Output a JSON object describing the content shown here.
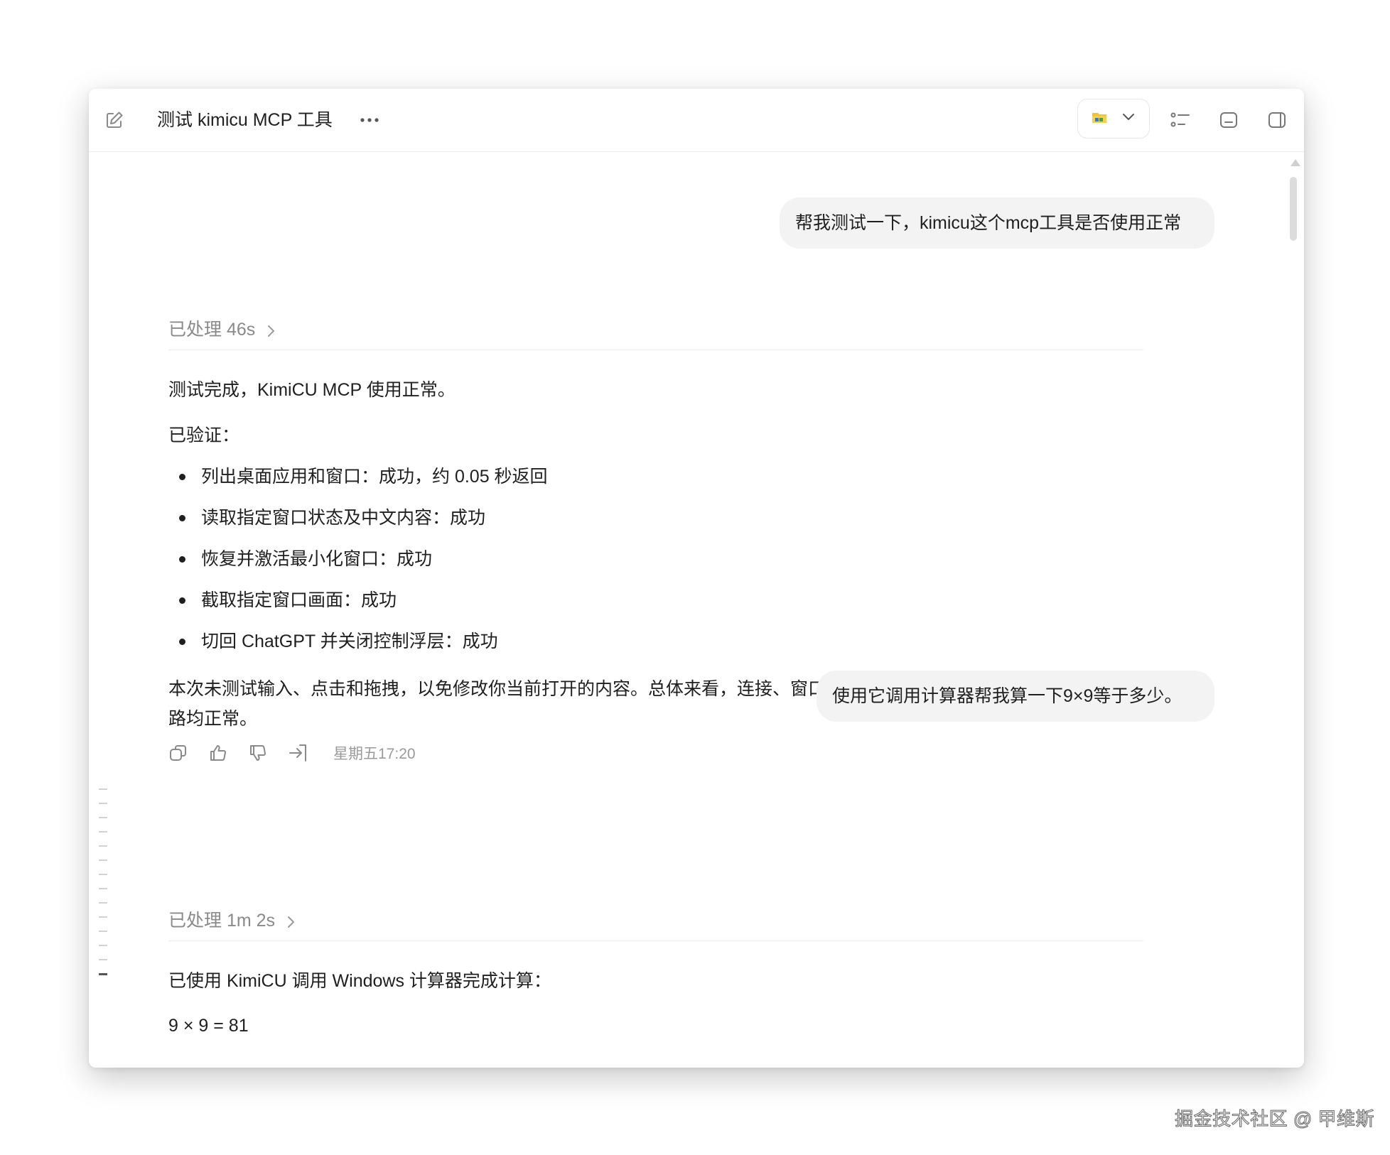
{
  "window": {
    "title": "测试 kimicu MCP 工具"
  },
  "icons": {
    "new_chat": "edit-icon",
    "more": "more-dots-icon",
    "workspace": "folder-icon",
    "dropdown": "chevron-down-icon",
    "list": "list-icon",
    "minimize": "minimize-icon",
    "panel": "side-panel-icon"
  },
  "conversation": {
    "user_message_1": "帮我测试一下，kimicu这个mcp工具是否使用正常",
    "processed_1": "已处理 46s",
    "reply_1": {
      "intro": "测试完成，KimiCU MCP 使用正常。",
      "verified_heading": "已验证：",
      "items": [
        "列出桌面应用和窗口：成功，约 0.05 秒返回",
        "读取指定窗口状态及中文内容：成功",
        "恢复并激活最小化窗口：成功",
        "截取指定窗口画面：成功",
        "切回 ChatGPT 并关闭控制浮层：成功"
      ],
      "summary": "本次未测试输入、点击和拖拽，以免修改你当前打开的内容。总体来看，连接、窗口识别、UIA 文本读取、截图和窗口控制链路均正常。",
      "timestamp": "星期五17:20"
    },
    "user_message_2": "使用它调用计算器帮我算一下9×9等于多少。",
    "processed_2": "已处理 1m 2s",
    "reply_2": {
      "intro": "已使用 KimiCU 调用 Windows 计算器完成计算：",
      "result": "9 × 9 = 81"
    }
  },
  "watermark": "掘金技术社区 @ 甲维斯"
}
